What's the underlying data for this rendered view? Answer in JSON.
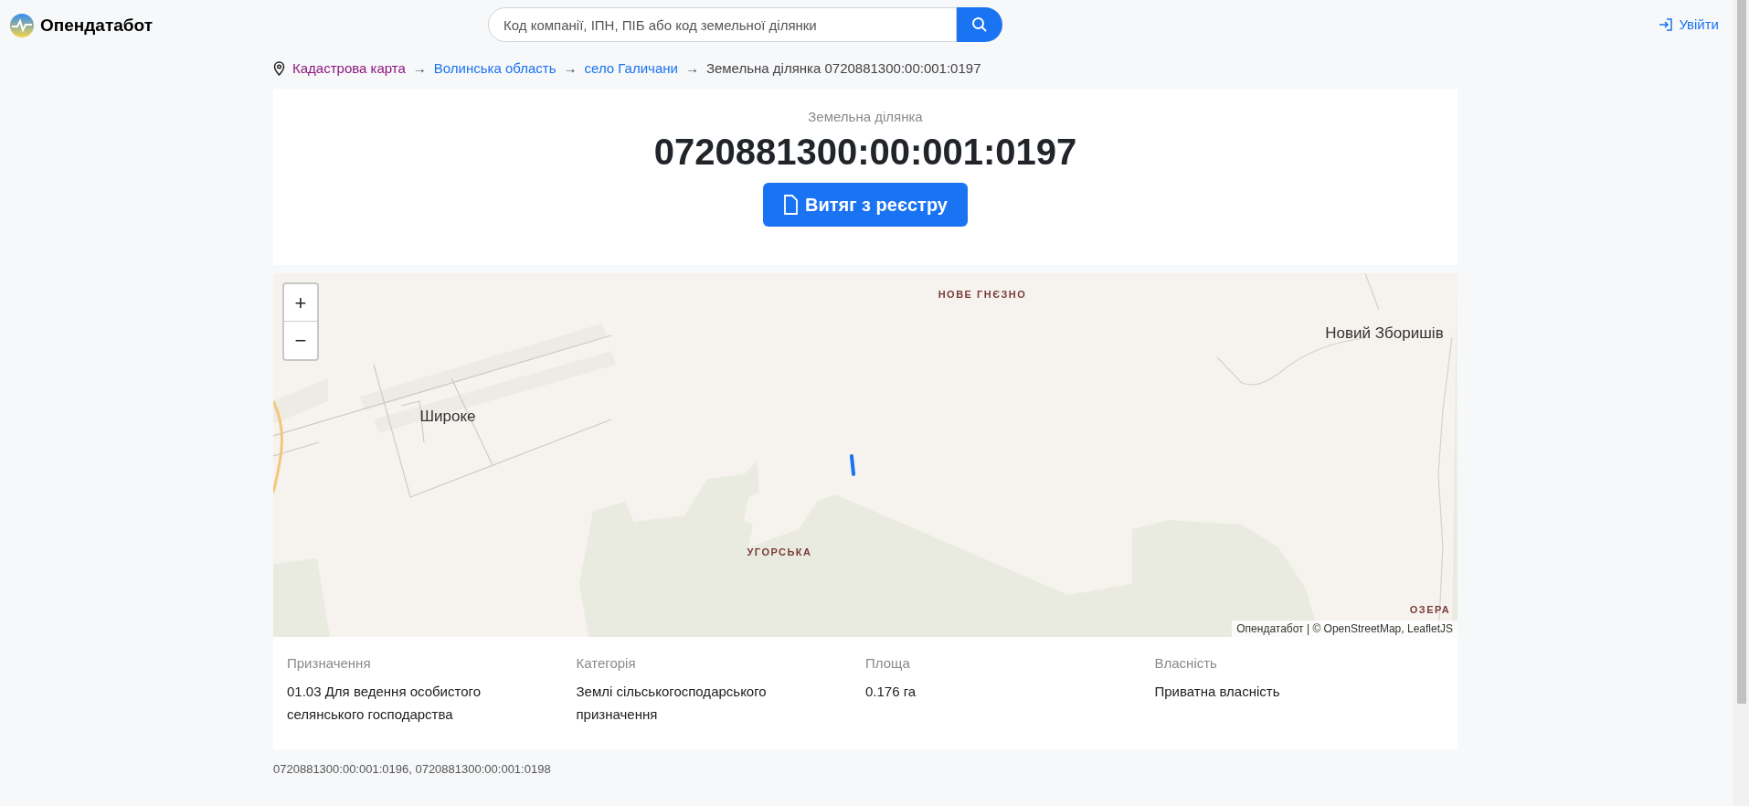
{
  "header": {
    "logo_text": "Опендатабот",
    "search": {
      "placeholder": "Код компанії, ІПН, ПІБ або код земельної ділянки"
    },
    "login": "Увійти"
  },
  "breadcrumbs": {
    "separator": "→",
    "items": [
      {
        "label": "Кадастрова карта",
        "kind": "visited"
      },
      {
        "label": "Волинська область",
        "kind": "link"
      },
      {
        "label": "село Галичани",
        "kind": "link"
      },
      {
        "label": "Земельна ділянка 0720881300:00:001:0197",
        "kind": "current"
      }
    ]
  },
  "parcel": {
    "subtitle": "Земельна ділянка",
    "number": "0720881300:00:001:0197",
    "button": "Витяг з реєстру"
  },
  "map": {
    "zoom_in": "+",
    "zoom_out": "−",
    "labels": [
      {
        "text": "НОВЕ ГНЄЗНО",
        "kind": "district"
      },
      {
        "text": "Новий Зборишів",
        "kind": "village"
      },
      {
        "text": "Широке",
        "kind": "village"
      },
      {
        "text": "УГОРСЬКА",
        "kind": "district"
      },
      {
        "text": "ОЗЕРА",
        "kind": "district"
      }
    ],
    "attribution": "Опендатабот | © OpenStreetMap, LeafletJS"
  },
  "details": [
    {
      "label": "Призначення",
      "value": "01.03 Для ведення особистого селянського господарства"
    },
    {
      "label": "Категорія",
      "value": "Землі сільськогосподарського призначення"
    },
    {
      "label": "Площа",
      "value": "0.176 га"
    },
    {
      "label": "Власність",
      "value": "Приватна власність"
    }
  ],
  "neighbors": "0720881300:00:001:0196, 0720881300:00:001:0198"
}
